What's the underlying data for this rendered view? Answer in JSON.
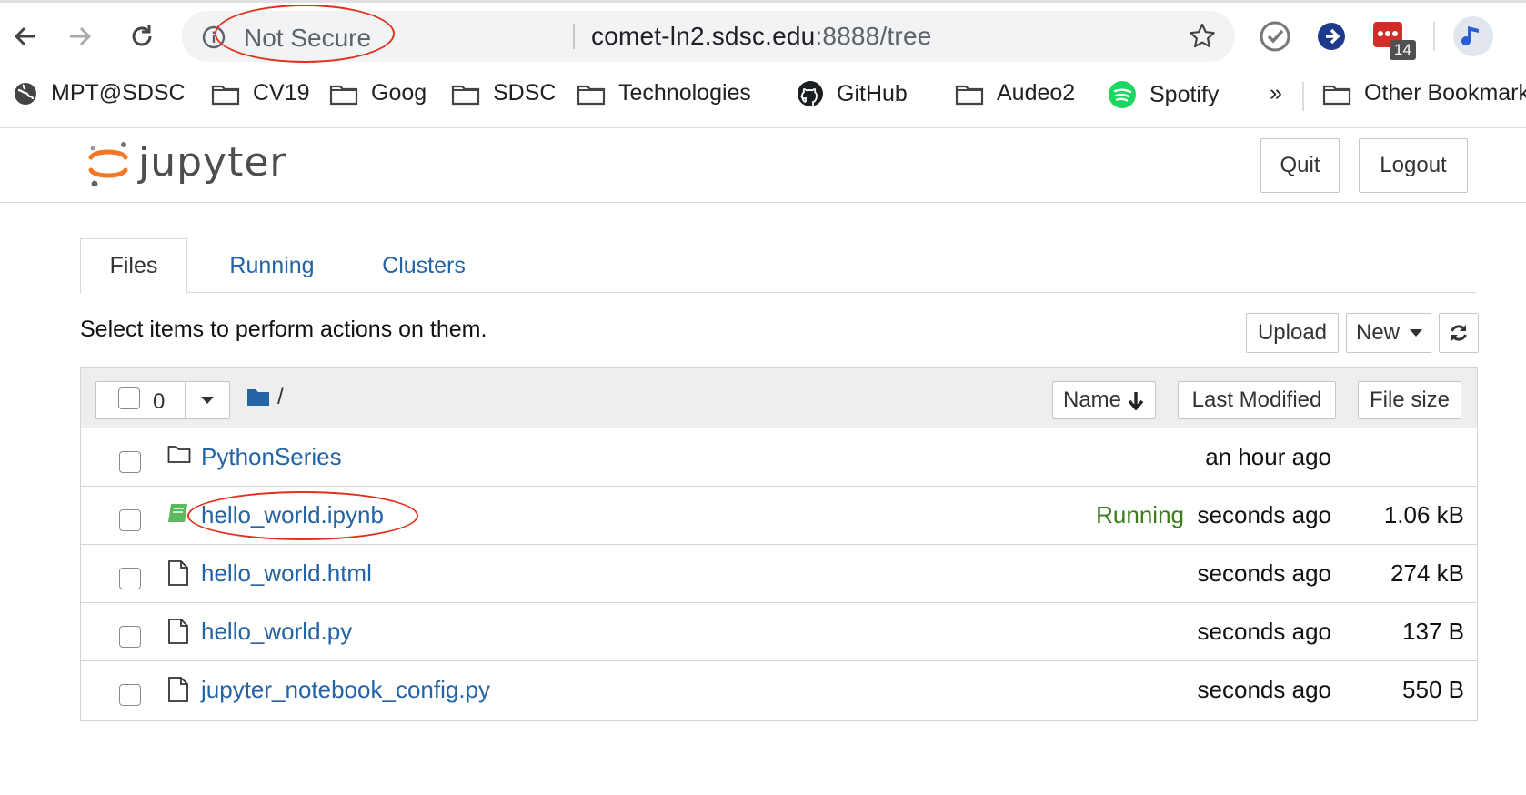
{
  "browser": {
    "not_secure_label": "Not Secure",
    "url_host": "comet-ln2.sdsc.edu",
    "url_rest": ":8888/tree",
    "extension_badge": "14",
    "bookmarks": [
      {
        "label": "MPT@SDSC",
        "icon": "globe-icon"
      },
      {
        "label": "CV19",
        "icon": "folder-icon"
      },
      {
        "label": "Goog",
        "icon": "folder-icon"
      },
      {
        "label": "SDSC",
        "icon": "folder-icon"
      },
      {
        "label": "Technologies",
        "icon": "folder-icon"
      },
      {
        "label": "GitHub",
        "icon": "github-icon"
      },
      {
        "label": "Audeo2",
        "icon": "folder-icon"
      },
      {
        "label": "Spotify",
        "icon": "spotify-icon"
      },
      {
        "label": "»",
        "icon": "overflow-chevron"
      },
      {
        "label": "Other Bookmarks",
        "icon": "folder-icon"
      }
    ]
  },
  "jupyter": {
    "wordmark": "jupyter",
    "quit_label": "Quit",
    "logout_label": "Logout",
    "tabs": [
      {
        "label": "Files",
        "active": true
      },
      {
        "label": "Running",
        "active": false
      },
      {
        "label": "Clusters",
        "active": false
      }
    ],
    "select_message": "Select items to perform actions on them.",
    "upload_label": "Upload",
    "new_label": "New",
    "selected_count": "0",
    "current_path": "/",
    "columns": {
      "name": "Name",
      "last_modified": "Last Modified",
      "file_size": "File size"
    },
    "files": [
      {
        "name": "PythonSeries",
        "type": "folder",
        "status": "",
        "modified": "an hour ago",
        "size": ""
      },
      {
        "name": "hello_world.ipynb",
        "type": "notebook",
        "status": "Running",
        "modified": "seconds ago",
        "size": "1.06 kB"
      },
      {
        "name": "hello_world.html",
        "type": "file",
        "status": "",
        "modified": "seconds ago",
        "size": "274 kB"
      },
      {
        "name": "hello_world.py",
        "type": "file",
        "status": "",
        "modified": "seconds ago",
        "size": "137 B"
      },
      {
        "name": "jupyter_notebook_config.py",
        "type": "file",
        "status": "",
        "modified": "seconds ago",
        "size": "550 B"
      }
    ]
  },
  "colors": {
    "link": "#2463a4",
    "running": "#3c7a1e",
    "annotation": "#e0331e",
    "jupyter_orange": "#f37726"
  }
}
